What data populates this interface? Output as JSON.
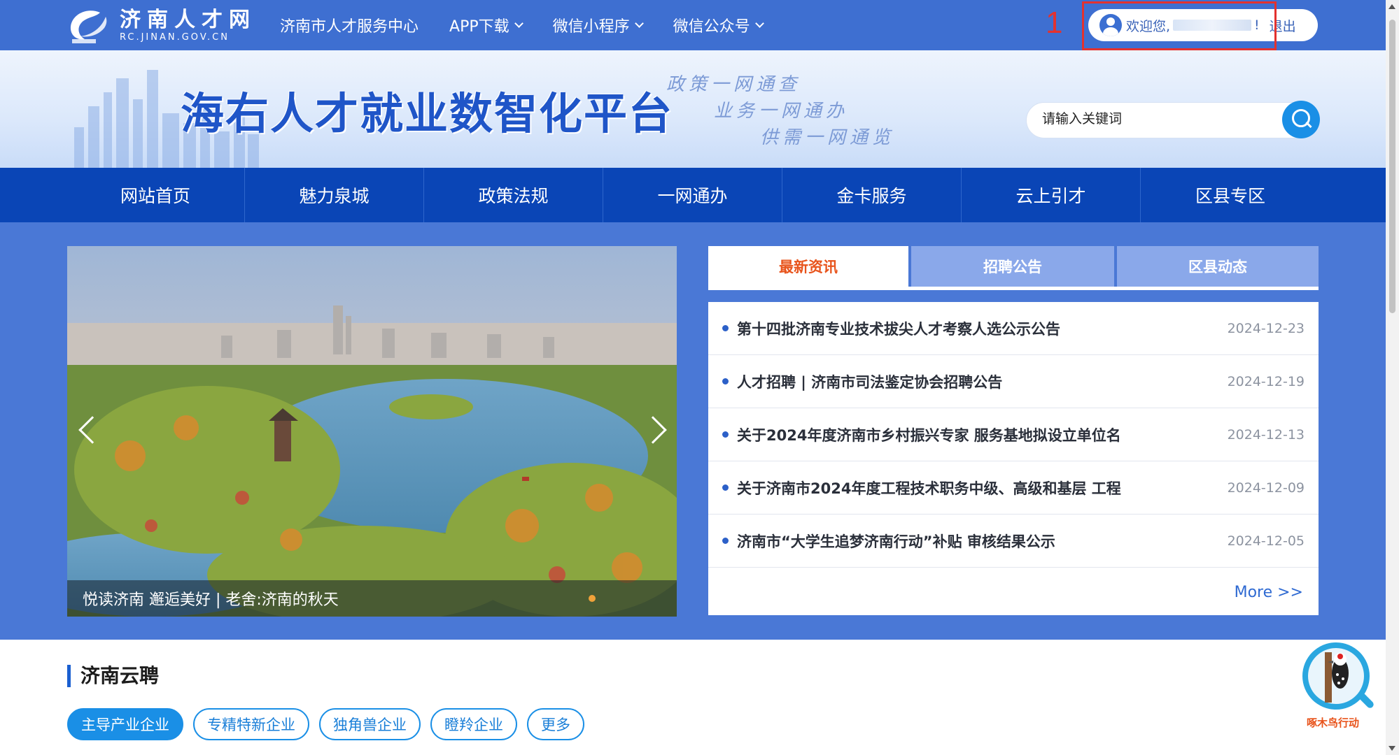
{
  "topbar": {
    "logo_cn": "济南人才网",
    "logo_en": "RC.JINAN.GOV.CN",
    "nav": [
      {
        "label": "济南市人才服务中心"
      },
      {
        "label": "APP下载"
      },
      {
        "label": "微信小程序"
      },
      {
        "label": "微信公众号"
      }
    ],
    "annotation_number": "1",
    "welcome": "欢迎您,",
    "welcome_suffix": "!",
    "logout": "退出"
  },
  "banner": {
    "title": "海右人才就业数智化平台",
    "slogans": [
      "政策一网通查",
      "业务一网通办",
      "供需一网通览"
    ],
    "search_placeholder": "请输入关键词"
  },
  "mainnav": {
    "items": [
      "网站首页",
      "魅力泉城",
      "政策法规",
      "一网通办",
      "金卡服务",
      "云上引才",
      "区县专区"
    ]
  },
  "carousel": {
    "caption": "悦读济南 邂逅美好 | 老舍:济南的秋天"
  },
  "news": {
    "tabs": [
      "最新资讯",
      "招聘公告",
      "区县动态"
    ],
    "active_tab": 0,
    "items": [
      {
        "title": "第十四批济南专业技术拔尖人才考察人选公示公告",
        "date": "2024-12-23"
      },
      {
        "title": "人才招聘 | 济南市司法鉴定协会招聘公告",
        "date": "2024-12-19"
      },
      {
        "title": "关于2024年度济南市乡村振兴专家 服务基地拟设立单位名",
        "date": "2024-12-13"
      },
      {
        "title": "关于济南市2024年度工程技术职务中级、高级和基层 工程",
        "date": "2024-12-09"
      },
      {
        "title": "济南市“大学生追梦济南行动”补贴 审核结果公示",
        "date": "2024-12-05"
      }
    ],
    "more": "More >>"
  },
  "cloud_hiring": {
    "title": "济南云聘",
    "categories": [
      "主导产业企业",
      "专精特新企业",
      "独角兽企业",
      "瞪羚企业",
      "更多"
    ],
    "active": 0
  },
  "badge": {
    "text": "啄木鸟行动"
  },
  "colors": {
    "topbar": "#3e6fd1",
    "mainnav": "#0a45b6",
    "page_bg": "#4a78d6",
    "active_tab_text": "#e8541c",
    "accent": "#1a8fe6",
    "annotation": "#e3322f"
  }
}
